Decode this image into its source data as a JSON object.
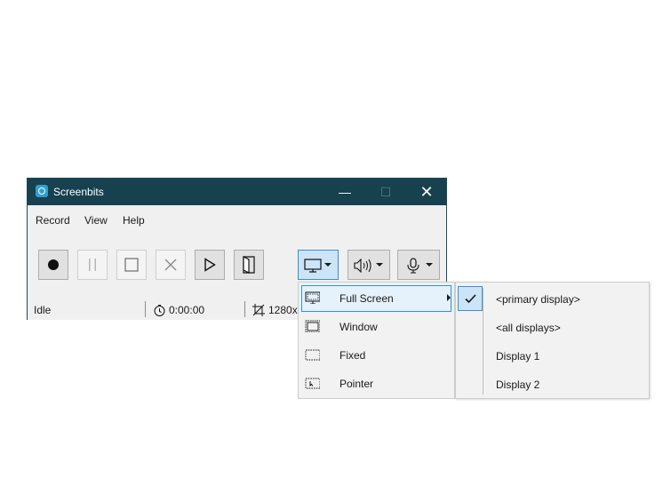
{
  "window": {
    "title": "Screenbits",
    "controls": {
      "minimize": "—",
      "maximize": "☐",
      "close": "✕"
    }
  },
  "menubar": {
    "items": [
      "Record",
      "View",
      "Help"
    ]
  },
  "toolbar": {
    "buttons": [
      {
        "icon": "record-icon",
        "enabled": true
      },
      {
        "icon": "pause-icon",
        "enabled": false
      },
      {
        "icon": "stop-icon",
        "enabled": false
      },
      {
        "icon": "discard-icon",
        "enabled": false
      },
      {
        "icon": "play-icon",
        "enabled": true
      },
      {
        "icon": "open-folder-icon",
        "enabled": true
      }
    ],
    "dropdowns": [
      {
        "icon": "monitor-icon",
        "active": true
      },
      {
        "icon": "speaker-icon",
        "active": false
      },
      {
        "icon": "microphone-icon",
        "active": false
      }
    ]
  },
  "status": {
    "state": "Idle",
    "timer": "0:00:00",
    "resolution": "1280x"
  },
  "source_menu": {
    "items": [
      {
        "label": "Full Screen",
        "icon": "fullscreen-icon",
        "has_submenu": true,
        "highlighted": true
      },
      {
        "label": "Window",
        "icon": "window-icon"
      },
      {
        "label": "Fixed",
        "icon": "fixed-region-icon"
      },
      {
        "label": "Pointer",
        "icon": "pointer-region-icon"
      }
    ]
  },
  "display_submenu": {
    "items": [
      {
        "label": "<primary display>",
        "checked": true
      },
      {
        "label": "<all displays>"
      },
      {
        "label": "Display 1"
      },
      {
        "label": "Display 2"
      }
    ]
  },
  "colors": {
    "titlebar": "#17414f",
    "accent": "#3a8fd6",
    "highlight": "#cce4f7"
  }
}
